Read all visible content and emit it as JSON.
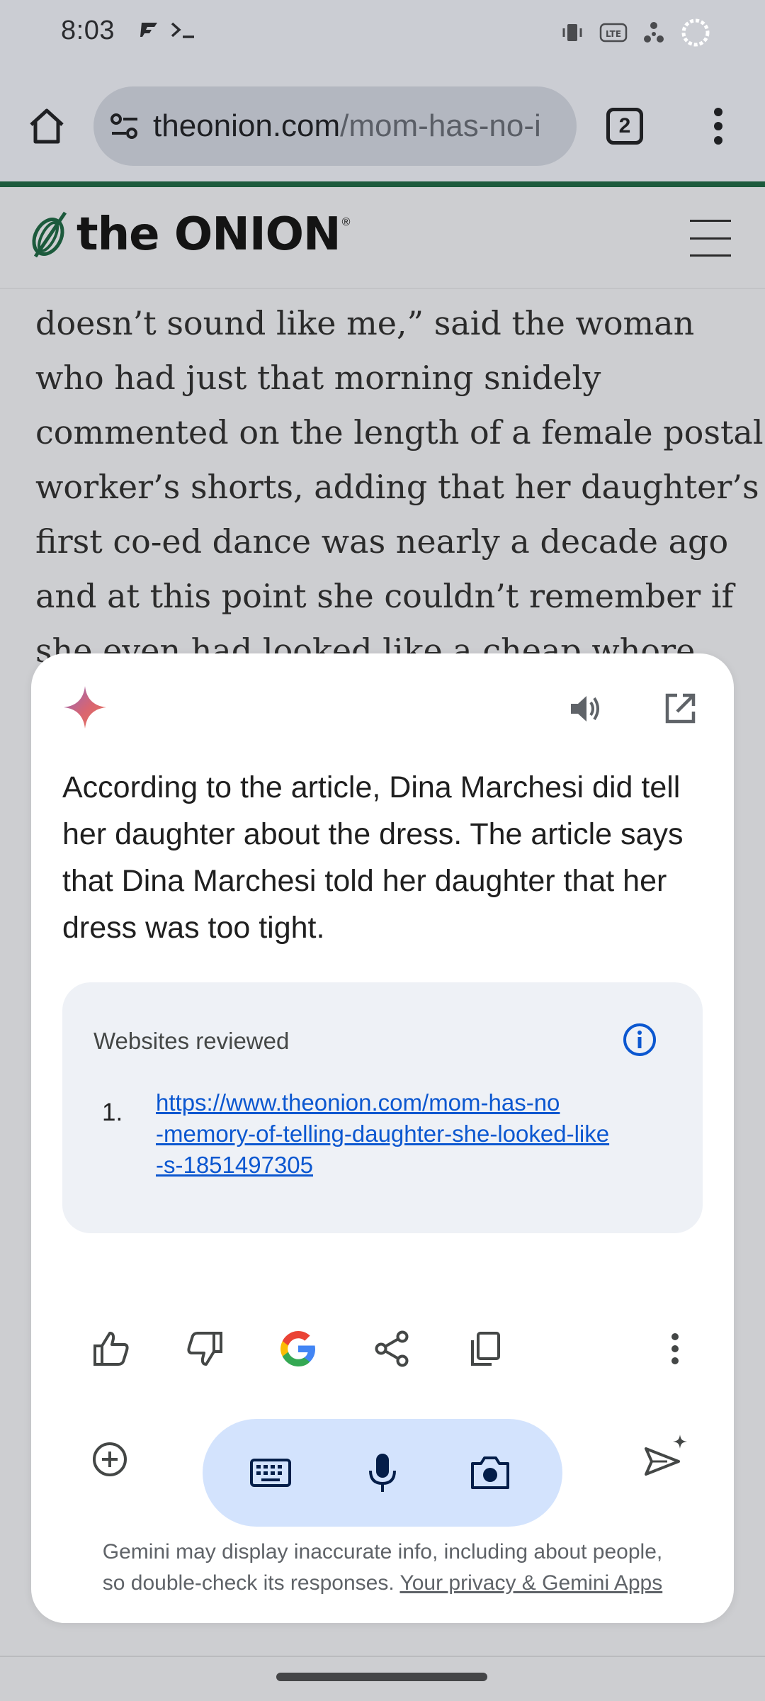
{
  "status_bar": {
    "time": "8:03",
    "left_icons": [
      "flipboard-icon",
      "terminal-icon"
    ],
    "right_icons": [
      "vibrate-icon",
      "lte-icon",
      "signal-icon",
      "battery-icon"
    ],
    "lte_label": "LTE"
  },
  "browser": {
    "url": "theonion.com/mom-has-no-",
    "url_domain": "theonion.com",
    "url_path": "/mom-has-no-i",
    "tab_count": "2"
  },
  "site": {
    "logo_text": "the ONION",
    "logo_reg": "®"
  },
  "article": {
    "lines": [
      "doesn’t sound like me,” said the woman",
      "who had just that morning snidely",
      "commented on the length of a female postal",
      "worker’s shorts, adding that her daughter’s",
      "first co-ed dance was nearly a decade ago",
      "and at this point she couldn’t remember if",
      "she even had looked like a cheap whore."
    ]
  },
  "gemini": {
    "answer": "According to the article, Dina Marchesi did tell her daughter about the dress. The article says that Dina Marchesi told her daughter that her dress was too tight.",
    "sources_title": "Websites reviewed",
    "sources": [
      {
        "num": "1.",
        "lines": [
          "https://www.theonion.com/mom-has-no",
          "-memory-of-telling-daughter-she-looked-like",
          "-s-1851497305"
        ]
      }
    ],
    "actions": [
      "thumbs-up-icon",
      "thumbs-down-icon",
      "google-icon",
      "share-icon",
      "copy-icon",
      "more-icon"
    ],
    "disclaimer_line1": "Gemini may display inaccurate info, including about people,",
    "disclaimer_line2": "so double-check its responses.",
    "disclaimer_link": "Your privacy & Gemini Apps"
  },
  "colors": {
    "accent_link": "#0b57d0",
    "pill_bg": "#d3e3fd",
    "onion_green": "#1c5a3c",
    "scrim_bg": "#cdced1"
  }
}
